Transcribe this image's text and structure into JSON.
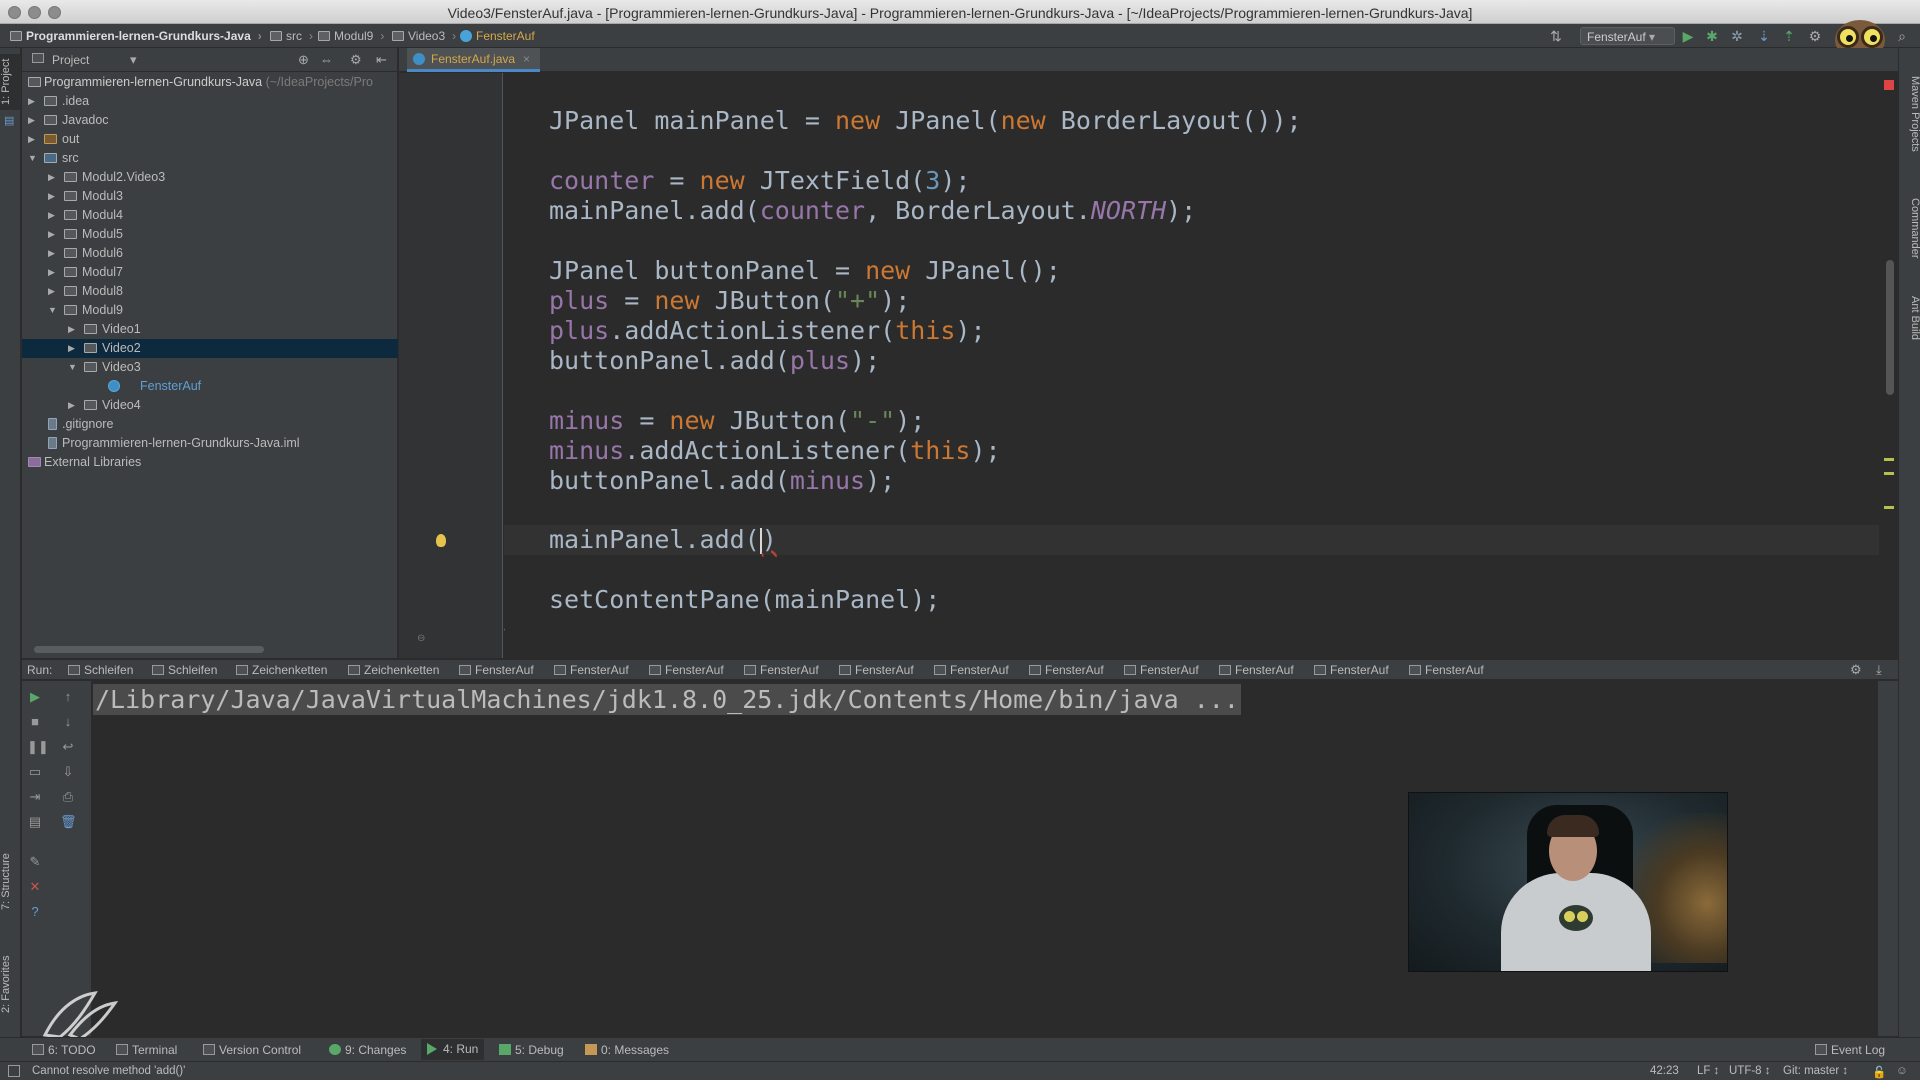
{
  "window": {
    "title": "Video3/FensterAuf.java - [Programmieren-lernen-Grundkurs-Java] - Programmieren-lernen-Grundkurs-Java - [~/IdeaProjects/Programmieren-lernen-Grundkurs-Java]"
  },
  "navbar": {
    "crumbs": [
      "Programmieren-lernen-Grundkurs-Java",
      "src",
      "Modul9",
      "Video3",
      "FensterAuf"
    ],
    "run_config": "FensterAuf"
  },
  "left_strip": {
    "project_tab": "1: Project",
    "structure_tab": "7: Structure",
    "favorites_tab": "2: Favorites"
  },
  "right_strip": {
    "maven_tab": "Maven Projects",
    "commander_tab": "Commander",
    "ant_tab": "Ant Build"
  },
  "project_panel": {
    "title": "Project",
    "root_label": "Programmieren-lernen-Grundkurs-Java",
    "root_hint": "(~/IdeaProjects/Pro",
    "items": [
      {
        "label": ".idea"
      },
      {
        "label": "Javadoc"
      },
      {
        "label": "out"
      },
      {
        "label": "src"
      },
      {
        "label": "Modul2.Video3"
      },
      {
        "label": "Modul3"
      },
      {
        "label": "Modul4"
      },
      {
        "label": "Modul5"
      },
      {
        "label": "Modul6"
      },
      {
        "label": "Modul7"
      },
      {
        "label": "Modul8"
      },
      {
        "label": "Modul9"
      },
      {
        "label": "Video1"
      },
      {
        "label": "Video2"
      },
      {
        "label": "Video3"
      },
      {
        "label": "FensterAuf"
      },
      {
        "label": "Video4"
      },
      {
        "label": ".gitignore"
      },
      {
        "label": "Programmieren-lernen-Grundkurs-Java.iml"
      },
      {
        "label": "External Libraries"
      }
    ]
  },
  "editor": {
    "tab_label": "FensterAuf.java",
    "lines": {
      "l1a": "JPanel mainPanel = ",
      "l1b": "new",
      "l1c": " JPanel(",
      "l1d": "new",
      "l1e": " BorderLayout());",
      "l2a": "counter",
      "l2b": " = ",
      "l2c": "new",
      "l2d": " JTextField(",
      "l2e": "3",
      "l2f": ");",
      "l3a": "mainPanel.add(",
      "l3b": "counter",
      "l3c": ", BorderLayout.",
      "l3d": "NORTH",
      "l3e": ");",
      "l4a": "JPanel buttonPanel = ",
      "l4b": "new",
      "l4c": " JPanel();",
      "l5a": "plus",
      "l5b": " = ",
      "l5c": "new",
      "l5d": " JButton(",
      "l5e": "\"+\"",
      "l5f": ");",
      "l6a": "plus",
      "l6b": ".addActionListener(",
      "l6c": "this",
      "l6d": ");",
      "l7a": "buttonPanel.add(",
      "l7b": "plus",
      "l7c": ");",
      "l8a": "minus",
      "l8b": " = ",
      "l8c": "new",
      "l8d": " JButton(",
      "l8e": "\"-\"",
      "l8f": ");",
      "l9a": "minus",
      "l9b": ".addActionListener(",
      "l9c": "this",
      "l9d": ");",
      "l10a": "buttonPanel.add(",
      "l10b": "minus",
      "l10c": ");",
      "l11a": "mainPanel.add(",
      "l11b": ")",
      "l12a": "setContentPane(mainPanel);",
      "l13a": "}"
    }
  },
  "run_panel": {
    "label": "Run:",
    "tabs": [
      "Schleifen",
      "Schleifen",
      "Zeichenketten",
      "Zeichenketten",
      "FensterAuf",
      "FensterAuf",
      "FensterAuf",
      "FensterAuf",
      "FensterAuf",
      "FensterAuf",
      "FensterAuf",
      "FensterAuf",
      "FensterAuf",
      "FensterAuf",
      "FensterAuf"
    ],
    "console_text": "/Library/Java/JavaVirtualMachines/jdk1.8.0_25.jdk/Contents/Home/bin/java ..."
  },
  "bottom_tools": {
    "todo": "6: TODO",
    "terminal": "Terminal",
    "version_control": "Version Control",
    "changes": "9: Changes",
    "run": "4: Run",
    "debug": "5: Debug",
    "messages": "0: Messages",
    "event_log": "Event Log"
  },
  "statusbar": {
    "message": "Cannot resolve method 'add()'",
    "position": "42:23",
    "line_sep": "LF ↕",
    "encoding": "UTF-8 ↕",
    "git": "Git: master ↕"
  },
  "icons": {
    "run": "play-icon",
    "debug": "bug-icon",
    "bulb": "lightbulb-icon"
  },
  "colors": {
    "keyword": "#cc7832",
    "field": "#9876aa",
    "number": "#6897bb",
    "string": "#6a8759",
    "selection": "#0d293e"
  }
}
